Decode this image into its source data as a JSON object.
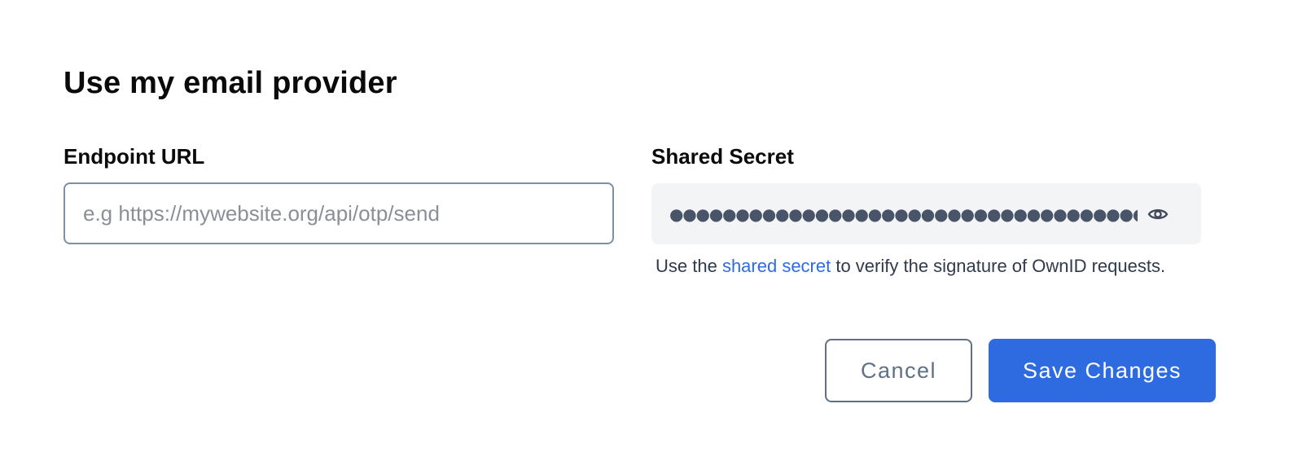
{
  "dialog": {
    "title": "Use my email provider"
  },
  "endpoint": {
    "label": "Endpoint URL",
    "value": "",
    "placeholder": "e.g https://mywebsite.org/api/otp/send"
  },
  "secret": {
    "label": "Shared Secret",
    "masked_value": "●●●●●●●●●●●●●●●●●●●●●●●●●●●●●●●●●●●●●●●●●●●●●●●●●●●●",
    "toggle_icon": "eye-icon",
    "help_prefix": "Use the ",
    "help_link": "shared secret",
    "help_suffix": " to verify the signature of OwnID requests."
  },
  "actions": {
    "cancel_label": "Cancel",
    "save_label": "Save Changes"
  },
  "colors": {
    "accent": "#2f6be0",
    "input_border": "#7f8fa6",
    "secret_bg": "#f3f4f5",
    "muted_text": "#2f3a4d"
  }
}
